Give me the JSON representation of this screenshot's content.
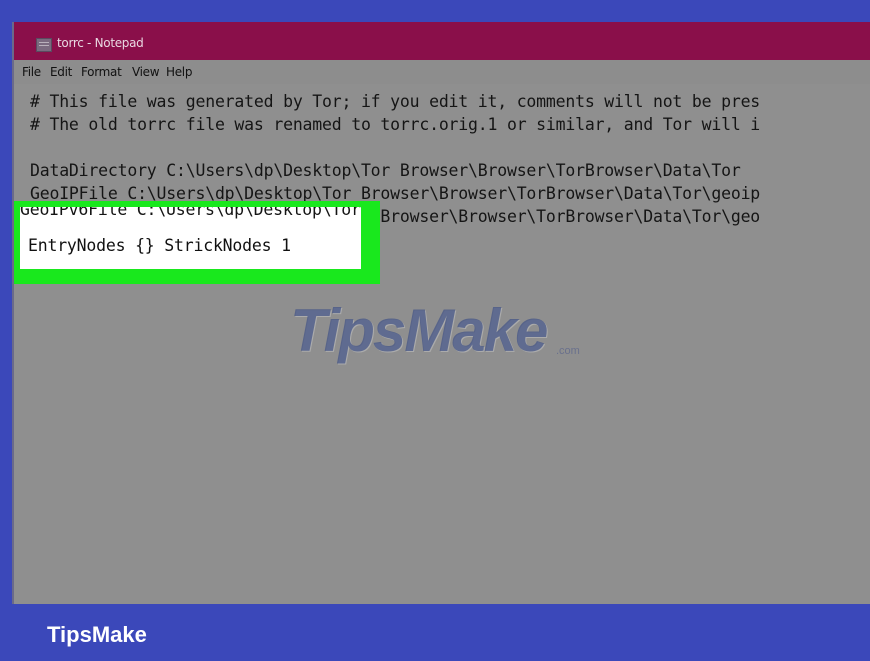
{
  "window": {
    "title": "torrc - Notepad"
  },
  "menu": {
    "items": [
      "File",
      "Edit",
      "Format",
      "View",
      "Help"
    ]
  },
  "editor": {
    "lines": [
      "# This file was generated by Tor; if you edit it, comments will not be pres",
      "# The old torrc file was renamed to torrc.orig.1 or similar, and Tor will i",
      "",
      "DataDirectory C:\\Users\\dp\\Desktop\\Tor Browser\\Browser\\TorBrowser\\Data\\Tor",
      "GeoIPFile C:\\Users\\dp\\Desktop\\Tor Browser\\Browser\\TorBrowser\\Data\\Tor\\geoip",
      "GeoIPv6File C:\\Users\\dp\\Desktop\\Tor Browser\\Browser\\TorBrowser\\Data\\Tor\\geo",
      "EntryNodes {} StrickNodes 1"
    ]
  },
  "watermark": {
    "text": "TipsMake",
    "suffix": ".com"
  },
  "brand": {
    "label": "TipsMake"
  },
  "colors": {
    "titlebar": "#8a0f4a",
    "highlight": "#19e81d",
    "brandbar": "#3b48ba"
  },
  "icons": {
    "app": "notepad-icon"
  }
}
